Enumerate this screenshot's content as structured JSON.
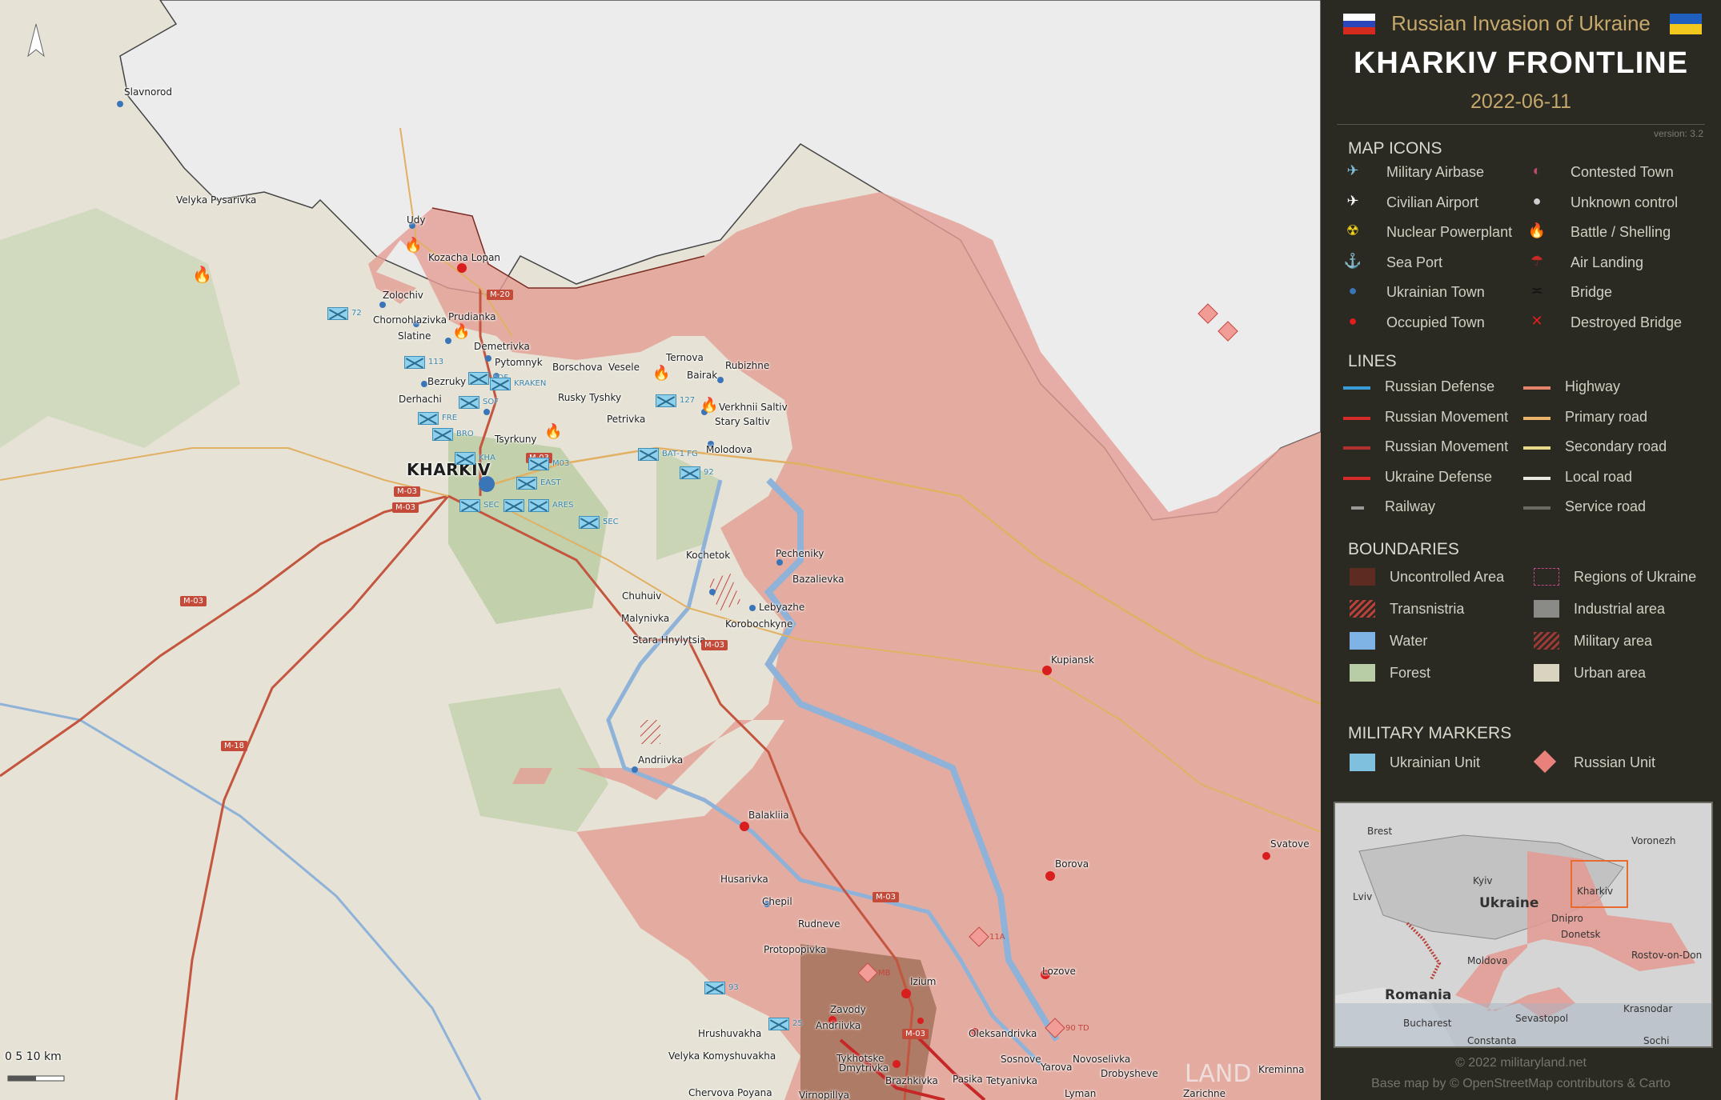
{
  "header": {
    "subtitle": "Russian Invasion of Ukraine",
    "title": "KHARKIV FRONTLINE",
    "date": "2022-06-11",
    "version": "version: 3.2"
  },
  "legend": {
    "map_icons_heading": "MAP ICONS",
    "map_icons": [
      {
        "label": "Military Airbase",
        "icon": "military-airbase-icon"
      },
      {
        "label": "Civilian Airport",
        "icon": "civilian-airport-icon"
      },
      {
        "label": "Nuclear Powerplant",
        "icon": "nuclear-icon"
      },
      {
        "label": "Sea Port",
        "icon": "anchor-icon"
      },
      {
        "label": "Ukrainian Town",
        "icon": "blue-dot-icon"
      },
      {
        "label": "Occupied Town",
        "icon": "red-dot-icon"
      },
      {
        "label": "Contested Town",
        "icon": "contested-dot-icon"
      },
      {
        "label": "Unknown control",
        "icon": "gray-dot-icon"
      },
      {
        "label": "Battle / Shelling",
        "icon": "fire-icon"
      },
      {
        "label": "Air Landing",
        "icon": "parachute-icon"
      },
      {
        "label": "Bridge",
        "icon": "bridge-icon"
      },
      {
        "label": "Destroyed Bridge",
        "icon": "destroyed-bridge-icon"
      }
    ],
    "lines_heading": "LINES",
    "lines": [
      {
        "label": "Russian Defense",
        "color": "#3a9bd9"
      },
      {
        "label": "Russian Movement",
        "color": "#d62b2b"
      },
      {
        "label": "Russian Movement",
        "color": "#b23030"
      },
      {
        "label": "Ukraine Defense",
        "color": "#d62b2b"
      },
      {
        "label": "Railway",
        "color": "#9a9a9a"
      },
      {
        "label": "Highway",
        "color": "#e6836b"
      },
      {
        "label": "Primary road",
        "color": "#e8b36a"
      },
      {
        "label": "Secondary road",
        "color": "#e8d88a"
      },
      {
        "label": "Local road",
        "color": "#e8e8e0"
      },
      {
        "label": "Service road",
        "color": "#6a6a60"
      }
    ],
    "boundaries_heading": "BOUNDARIES",
    "boundaries": [
      {
        "label": "Uncontrolled Area",
        "color": "#5e2b22"
      },
      {
        "label": "Transnistria",
        "color": "#b8423a"
      },
      {
        "label": "Water",
        "color": "#7fb2e5"
      },
      {
        "label": "Forest",
        "color": "#b8cca6"
      },
      {
        "label": "Regions of Ukraine",
        "color": "#c24a8a"
      },
      {
        "label": "Industrial area",
        "color": "#8a8a86"
      },
      {
        "label": "Military area",
        "color": "#9a3a35"
      },
      {
        "label": "Urban area",
        "color": "#d9d4c0"
      }
    ],
    "markers_heading": "MILITARY MARKERS",
    "markers": [
      {
        "label": "Ukrainian Unit",
        "color": "#7fc0de"
      },
      {
        "label": "Russian Unit",
        "color": "#e8817b"
      }
    ]
  },
  "inset": {
    "labels": [
      "Brest",
      "Voronezh",
      "Lviv",
      "Kyiv",
      "Kharkiv",
      "Ukraine",
      "Dnipro",
      "Donetsk",
      "Moldova",
      "Rostov-on-Don",
      "Romania",
      "Krasnodar",
      "Bucharest",
      "Sevastopol",
      "Constanta",
      "Sochi"
    ]
  },
  "credits": {
    "line1": "© 2022 militaryland.net",
    "line2": "Base map by © OpenStreetMap contributors & Carto"
  },
  "map": {
    "north": "N",
    "scale_label": "0    5    10 km",
    "watermark": "LAND",
    "city_major": "KHARKIV",
    "towns": [
      "Slavnorod",
      "Velyka Pysarivka",
      "Udy",
      "Kozacha Lopan",
      "Zolochiv",
      "Chornohlazivka",
      "Prudianka",
      "Slatine",
      "Demetrivka",
      "Pytomnyk",
      "Borschova",
      "Vesele",
      "Ternova",
      "Rubizhne",
      "Bezruky",
      "Derhachi",
      "Rusky Tyshky",
      "Bairak",
      "Verkhnii Saltiv",
      "Stary Saltiv",
      "Petrivka",
      "Tsyrkuny",
      "Molodova",
      "Kochetok",
      "Pecheniky",
      "Bazalievka",
      "Chuhuiv",
      "Lebyazhe",
      "Malynivka",
      "Korobochkyne",
      "Stara Hnylytsia",
      "Kupiansk",
      "Andriivka",
      "Balakliia",
      "Svatove",
      "Borova",
      "Husarivka",
      "Chepil",
      "Rudneve",
      "Protopopivka",
      "Lozove",
      "Izium",
      "Zavody",
      "Andriivka",
      "Hrushuvakha",
      "Oleksandrivka",
      "Tykhotske",
      "Sosnove",
      "Velyka Komyshuvakha",
      "Dmytrivka",
      "Yarova",
      "Novoselivka",
      "Drobysheve",
      "Brazhkivka",
      "Pasika",
      "Tetyanivka",
      "Chervova Poyana",
      "Virnopillya",
      "Zarichne",
      "Kreminna",
      "Lyman"
    ],
    "roads": [
      "M-20",
      "M-03",
      "M-03",
      "M-03",
      "M-03",
      "M-03",
      "M-03",
      "M-03",
      "M-18"
    ],
    "ua_units": [
      "72",
      "113",
      "SOF",
      "KRAKEN",
      "SOF",
      "FRE",
      "BRO",
      "KHA",
      "EAST",
      "M03",
      "SEC",
      "MI",
      "ARES",
      "SEC",
      "5",
      "127",
      "BAT-1 FG",
      "92",
      "93",
      "25"
    ],
    "ru_units": [
      "11A",
      "MB",
      "90 TD"
    ]
  }
}
